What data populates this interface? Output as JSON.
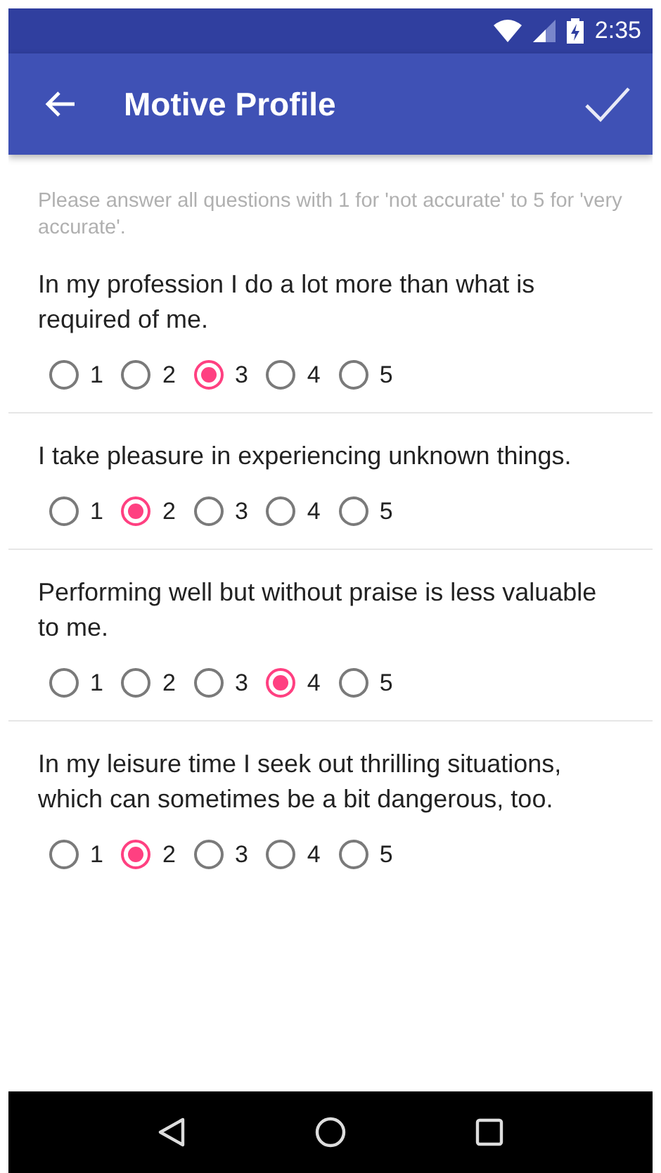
{
  "status_bar": {
    "time": "2:35"
  },
  "app_bar": {
    "title": "Motive Profile"
  },
  "instructions": "Please answer all questions with 1 for 'not accurate' to 5 for 'very accurate'.",
  "questions": [
    {
      "text": "In my profession I do a lot more than what is required of me.",
      "options": [
        {
          "label": "1",
          "selected": false
        },
        {
          "label": "2",
          "selected": false
        },
        {
          "label": "3",
          "selected": true
        },
        {
          "label": "4",
          "selected": false
        },
        {
          "label": "5",
          "selected": false
        }
      ]
    },
    {
      "text": "I take pleasure in experiencing unknown things.",
      "options": [
        {
          "label": "1",
          "selected": false
        },
        {
          "label": "2",
          "selected": true
        },
        {
          "label": "3",
          "selected": false
        },
        {
          "label": "4",
          "selected": false
        },
        {
          "label": "5",
          "selected": false
        }
      ]
    },
    {
      "text": "Performing well but without praise is less valuable to me.",
      "options": [
        {
          "label": "1",
          "selected": false
        },
        {
          "label": "2",
          "selected": false
        },
        {
          "label": "3",
          "selected": false
        },
        {
          "label": "4",
          "selected": true
        },
        {
          "label": "5",
          "selected": false
        }
      ]
    },
    {
      "text": "In my leisure time I seek out thrilling situations, which can sometimes be a bit dangerous, too.",
      "options": [
        {
          "label": "1",
          "selected": false
        },
        {
          "label": "2",
          "selected": true
        },
        {
          "label": "3",
          "selected": false
        },
        {
          "label": "4",
          "selected": false
        },
        {
          "label": "5",
          "selected": false
        }
      ]
    }
  ]
}
